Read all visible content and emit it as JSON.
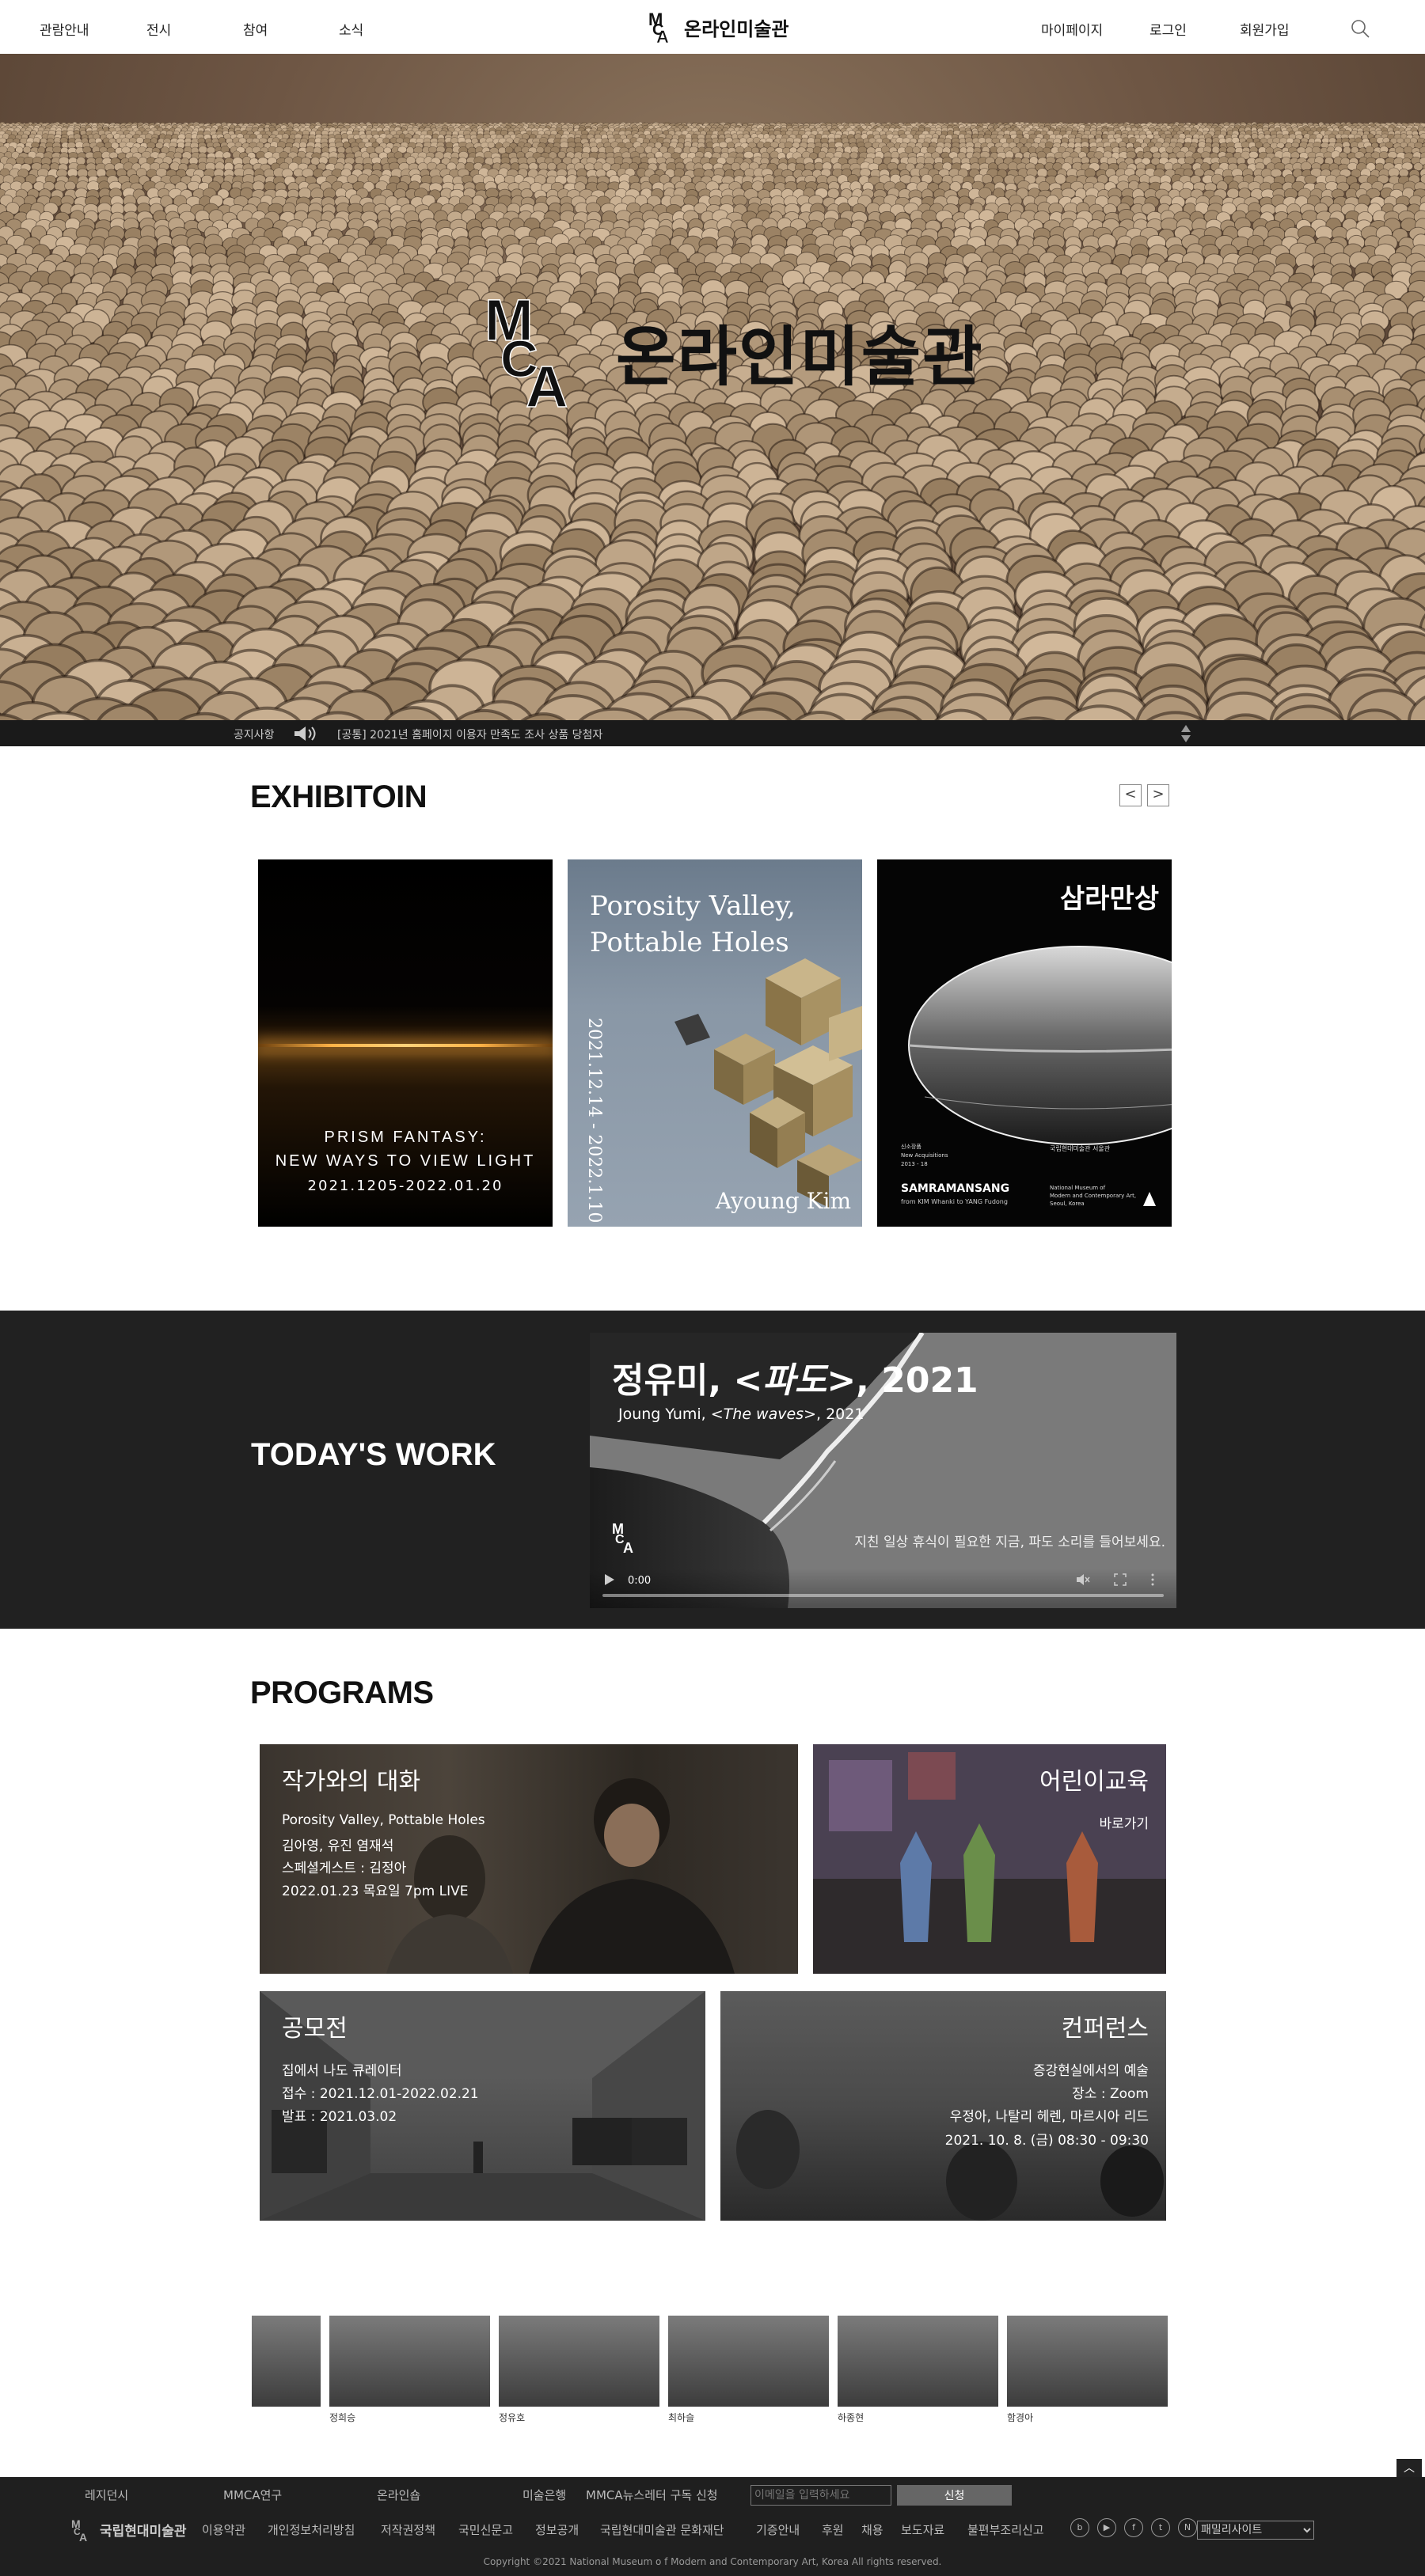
{
  "nav": {
    "left_items": [
      "관람안내",
      "전시",
      "참여",
      "소식"
    ],
    "logo_text": "온라인미술관",
    "right_items": [
      "마이페이지",
      "로그인",
      "회원가입"
    ]
  },
  "hero": {
    "logo_text": "온라인미술관"
  },
  "notice": {
    "label": "공지사항",
    "text": "[공통] 2021년 홈페이지 이용자 만족도 조사 상품 당첨자"
  },
  "exhibition": {
    "title": "EXHIBITOIN",
    "prev": "<",
    "next": ">",
    "cards": [
      {
        "title_line1": "PRISM FANTASY:",
        "title_line2": "NEW WAYS TO VIEW LIGHT",
        "date": "2021.1205-2022.01.20"
      },
      {
        "title_line1": "Porosity Valley,",
        "title_line2": "Pottable Holes",
        "date": "2021.12.14 - 2022.1.10",
        "artist": "Ayoung Kim"
      },
      {
        "title": "삼라만상",
        "name": "SAMRAMANSANG",
        "sub": "from KIM Whanki to YANG Fudong",
        "meta_line1": "신소장품",
        "meta_line2": "New Acquisitions",
        "meta_line3": "2013 - 18",
        "kr_museum": "국립현대미술관 서울관",
        "museum_line1": "National Museum of",
        "museum_line2": "Modern and Contemporary Art,",
        "museum_line3": "Seoul, Korea"
      }
    ]
  },
  "today": {
    "title": "TODAY'S WORK",
    "video_title_prefix": "정유미, <",
    "video_title_em": "파도",
    "video_title_suffix": ">, 2021",
    "video_sub_prefix": "Joung Yumi, <",
    "video_sub_em": "The waves",
    "video_sub_suffix": ">, 2021",
    "caption": "지친 일상 휴식이 필요한 지금, 파도 소리를 들어보세요.",
    "time": "0:00"
  },
  "programs": {
    "title": "PROGRAMS",
    "items": [
      {
        "title": "작가와의 대화",
        "lines": [
          "Porosity Valley, Pottable Holes",
          "김아영, 유진 염재석",
          "스페셜게스트 : 김정아",
          "2022.01.23 목요일 7pm  LIVE"
        ]
      },
      {
        "title": "어린이교육",
        "lines": [
          "바로가기"
        ]
      },
      {
        "title": "공모전",
        "lines": [
          "집에서 나도 큐레이터",
          "접수 : 2021.12.01-2022.02.21",
          "발표 : 2021.03.02"
        ]
      },
      {
        "title": "컨퍼런스",
        "lines": [
          "증강현실에서의 예술",
          "장소 : Zoom",
          "우정아, 나탈리 헤렌, 마르시아 리드",
          "2021. 10. 8. (금) 08:30 - 09:30"
        ]
      }
    ]
  },
  "thumbnails": {
    "labels": [
      "정희승",
      "정유호",
      "최하슬",
      "하종현",
      "함경아"
    ]
  },
  "footer": {
    "top_links": [
      "레지던시",
      "MMCA연구",
      "온라인숍",
      "미술은행",
      "MMCA뉴스레터 구독 신청"
    ],
    "email_placeholder": "이메일을 입력하세요",
    "submit_label": "신청",
    "logo_text": "국립현대미술관",
    "links": [
      "이용약관",
      "개인정보처리방침",
      "저작권정책",
      "국민신문고",
      "정보공개",
      "국립현대미술관 문화재단",
      "기증안내",
      "후원",
      "채용",
      "보도자료",
      "불편부조리신고"
    ],
    "social": [
      "blog",
      "youtube",
      "facebook",
      "twitter",
      "naver"
    ],
    "family_site": "패밀리사이트",
    "copyright": "Copyright ©2021 National Museum o f Modern and Contemporary Art, Korea All rights reserved.",
    "to_top": "︿"
  }
}
